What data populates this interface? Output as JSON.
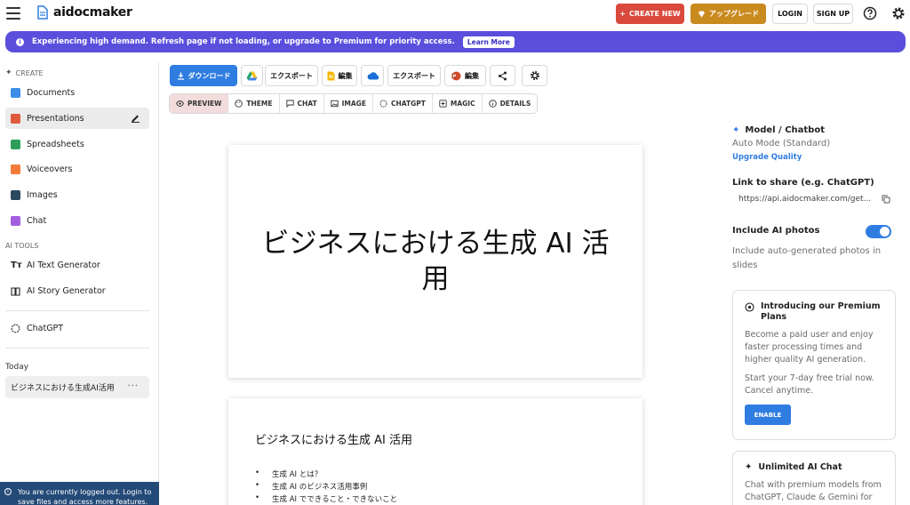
{
  "app": {
    "logo_text": "aidocmaker"
  },
  "header": {
    "create_new": "CREATE NEW",
    "upgrade": "アップグレード",
    "login": "LOGIN",
    "signup": "SIGN UP"
  },
  "banner": {
    "text": "Experiencing high demand. Refresh page if not loading, or upgrade to Premium for priority access.",
    "link": "Learn More"
  },
  "sidebar": {
    "create_label": "CREATE",
    "items": [
      {
        "label": "Documents",
        "color": "#3b8ee8"
      },
      {
        "label": "Presentations",
        "color": "#e05a3c"
      },
      {
        "label": "Spreadsheets",
        "color": "#2f9e5b"
      },
      {
        "label": "Voiceovers",
        "color": "#f07b3a"
      },
      {
        "label": "Images",
        "color": "#2b4a5e"
      },
      {
        "label": "Chat",
        "color": "#a35ee0"
      }
    ],
    "ai_tools_label": "AI TOOLS",
    "tools": [
      {
        "label": "AI Text Generator"
      },
      {
        "label": "AI Story Generator"
      }
    ],
    "chatgpt": "ChatGPT",
    "today_label": "Today",
    "today_item": "ビジネスにおける生成AI活用",
    "today_more": "···",
    "logged_out": "You are currently logged out. Login to save files and access more features."
  },
  "toolbar": {
    "download": "ダウンロード",
    "export_gdrive": "エクスポート",
    "edit_gdocs": "編集",
    "export_onedrive": "エクスポート",
    "edit_office": "編集"
  },
  "tabs": [
    "PREVIEW",
    "THEME",
    "CHAT",
    "IMAGE",
    "CHATGPT",
    "MAGIC",
    "DETAILS"
  ],
  "slides": {
    "slide1_title": "ビジネスにおける生成 AI 活用",
    "slide2_title": "ビジネスにおける生成 AI 活用",
    "slide2_bullets": [
      "生成 AI とは？",
      "生成 AI のビジネス活用事例",
      "生成 AI でできること・できないこと"
    ]
  },
  "right_panel": {
    "model_title": "Model / Chatbot",
    "model_value": "Auto Mode (Standard)",
    "upgrade_quality": "Upgrade Quality",
    "share_label": "Link to share (e.g. ChatGPT)",
    "share_url": "https://api.aidocmaker.com/get...",
    "include_photos_label": "Include AI photos",
    "include_photos_desc": "Include auto-generated photos in slides",
    "include_photos_on": true,
    "premium_title": "Introducing our Premium Plans",
    "premium_body1": "Become a paid user and enjoy faster processing times and higher quality AI generation.",
    "premium_body2": "Start your 7-day free trial now. Cancel anytime.",
    "enable": "ENABLE",
    "chat_title": "Unlimited AI Chat",
    "chat_body": "Chat with premium models from ChatGPT, Claude & Gemini for free."
  }
}
